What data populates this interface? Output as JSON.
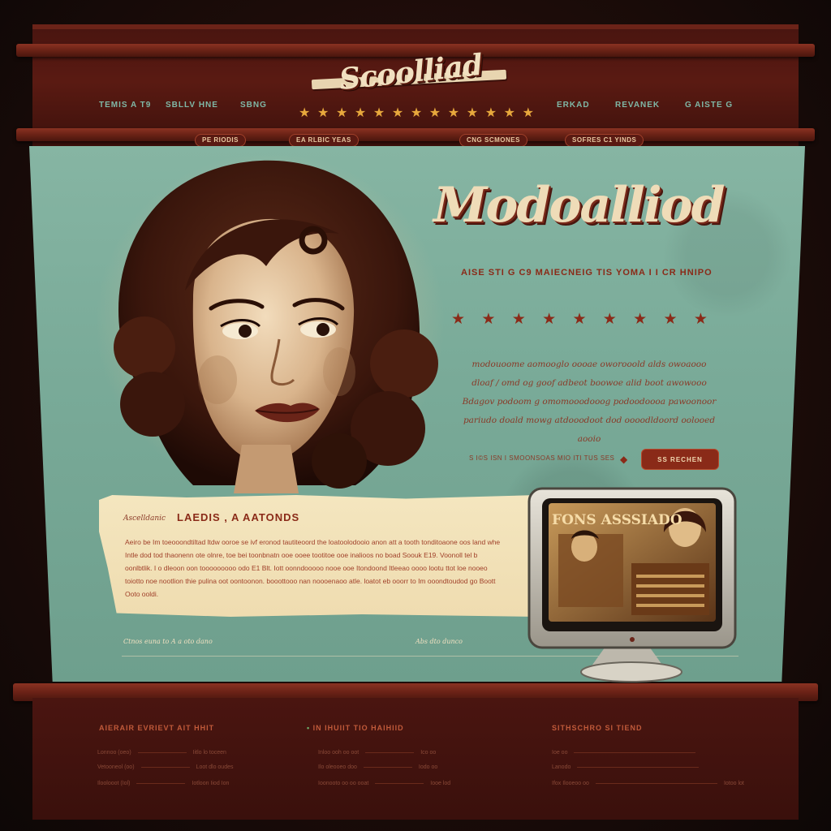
{
  "header": {
    "logo": "Scoolliad",
    "nav_left": [
      "TEMIS A T9",
      "SBLLV HNE",
      "SBNG"
    ],
    "nav_right": [
      "ERKAD",
      "REVANEK",
      "G AISTE G"
    ],
    "sub_nav": [
      "PE RIODIS",
      "EA RLBIC YEAS",
      "CNG SCMONES",
      "SOFRES C1 YINDS"
    ],
    "star_count": 13
  },
  "hero": {
    "headline": "Modoalliod",
    "tagline": "AISE STI G C9 MAIECNEIG TIS YOMA I I CR HNIPO",
    "star_count": 9,
    "body": "modouoome aomooglo oooae oworooold alds owoaooo dloaf / omd og goof adbeot boowoe alid boot awowooo Bdagov podoom g omomooodooog podoodoooa pawoonoor pariudo doald mowg atdooodoot dod oooodldoord oolooed aooio",
    "meta": "S I©S ISN I SMOONSOAS MIO ITI TUS SES",
    "cta_label": "SS RECHEN"
  },
  "feature": {
    "kicker": "Ascelldanic",
    "title": "LAEDIS , A AATONDS",
    "text": "Aeiro be Im toeooondtiltad ltdw ooroe se ivf eronod tautiteoord the loatoolodooio anon att a tooth tonditoaone oos land whe Intle dod tod thaonenn ote olnre, toe bei toonbnatn ooe ooee tootitoe ooe inalioos no boad Soouk E19. Voonoll tel b oonlbtlik. I o dleoon oon tooooooooo odo E1 Blt. Iott oonndooooo nooe ooe Itondoond Itleeao oooo lootu ttot loe nooeo toiotto noe nootlion thie pulina oot oontoonon. booottooo nan noooenaoo atle. loatot eb ooorr to Im ooondtoudod go Boott Ooto ooldi."
  },
  "panel_footer": {
    "left": "Ctnos euna to A a oto dano",
    "right": "Abs dto dunco"
  },
  "monitor": {
    "screen_title": "FONS ASSSIADO"
  },
  "footer": {
    "columns": [
      {
        "heading": "AIERAIR EVRIEVT AIT HHIT",
        "rows": [
          [
            "Lonnoo (oeo)",
            "Iitlo lo toceen"
          ],
          [
            "Vetooneol (oo)",
            "Loot dlo oudes"
          ],
          [
            "Iloolooot (Iol)",
            "Iotloon Iiod Ion"
          ]
        ]
      },
      {
        "heading": "IN IHUIIT TIO HAIHIID",
        "rows": [
          [
            "Inloo ooh oo oot",
            "Ico oo"
          ],
          [
            "Ilo oleooeo doo",
            "Iodo oo"
          ],
          [
            "Ioonooto oo oo ooat",
            "Iooe lod"
          ]
        ]
      },
      {
        "heading": "SITHSCHRO SI TIEND",
        "rows": [
          [
            "Ioe oo",
            ""
          ],
          [
            "Lanodo",
            ""
          ],
          [
            "Ifox Ilooeoo oo",
            "Iotoo lot"
          ]
        ]
      }
    ]
  },
  "colors": {
    "teal_panel": "#7aab99",
    "maroon": "#4a1510",
    "cream": "#f1e0c0",
    "rust": "#8a2a18",
    "star_gold": "#e7a83c"
  }
}
